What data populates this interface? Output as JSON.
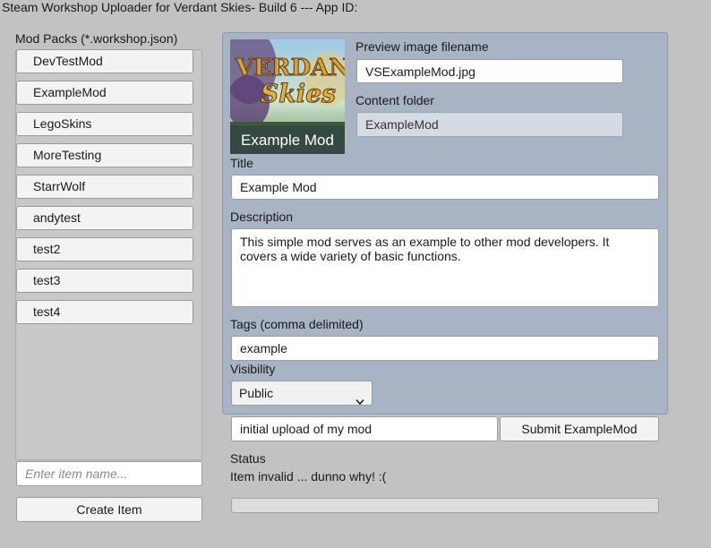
{
  "window": {
    "title": "Steam Workshop Uploader for Verdant Skies- Build 6 --- App ID:"
  },
  "sidebar": {
    "heading": "Mod Packs (*.workshop.json)",
    "items": [
      {
        "label": "DevTestMod"
      },
      {
        "label": "ExampleMod"
      },
      {
        "label": "LegoSkins"
      },
      {
        "label": "MoreTesting"
      },
      {
        "label": "StarrWolf"
      },
      {
        "label": "andytest"
      },
      {
        "label": "test2"
      },
      {
        "label": "test3"
      },
      {
        "label": "test4"
      }
    ],
    "new_item": {
      "placeholder": "Enter item name..."
    },
    "create_label": "Create Item"
  },
  "editor": {
    "preview_image": {
      "label": "Preview image filename",
      "value": "VSExampleMod.jpg",
      "logo_top": "VERDANT",
      "logo_bottom": "Skies",
      "caption": "Example Mod"
    },
    "content_folder": {
      "label": "Content folder",
      "value": "ExampleMod"
    },
    "title": {
      "label": "Title",
      "value": "Example Mod"
    },
    "description": {
      "label": "Description",
      "value": "This simple mod serves as an example to other mod developers. It covers a wide variety of basic functions."
    },
    "tags": {
      "label": "Tags (comma delimited)",
      "value": "example"
    },
    "visibility": {
      "label": "Visibility",
      "selected": "Public",
      "icon": "chevron-down-icon"
    }
  },
  "submit": {
    "change_note": "initial upload of my mod",
    "button_label": "Submit ExampleMod"
  },
  "status": {
    "label": "Status",
    "message": "Item invalid ... dunno why! :(",
    "progress": 0
  },
  "colors": {
    "background": "#c2c2c2",
    "panel": "#a8b4c3",
    "button": "#f3f3f3",
    "field": "#ffffff"
  }
}
